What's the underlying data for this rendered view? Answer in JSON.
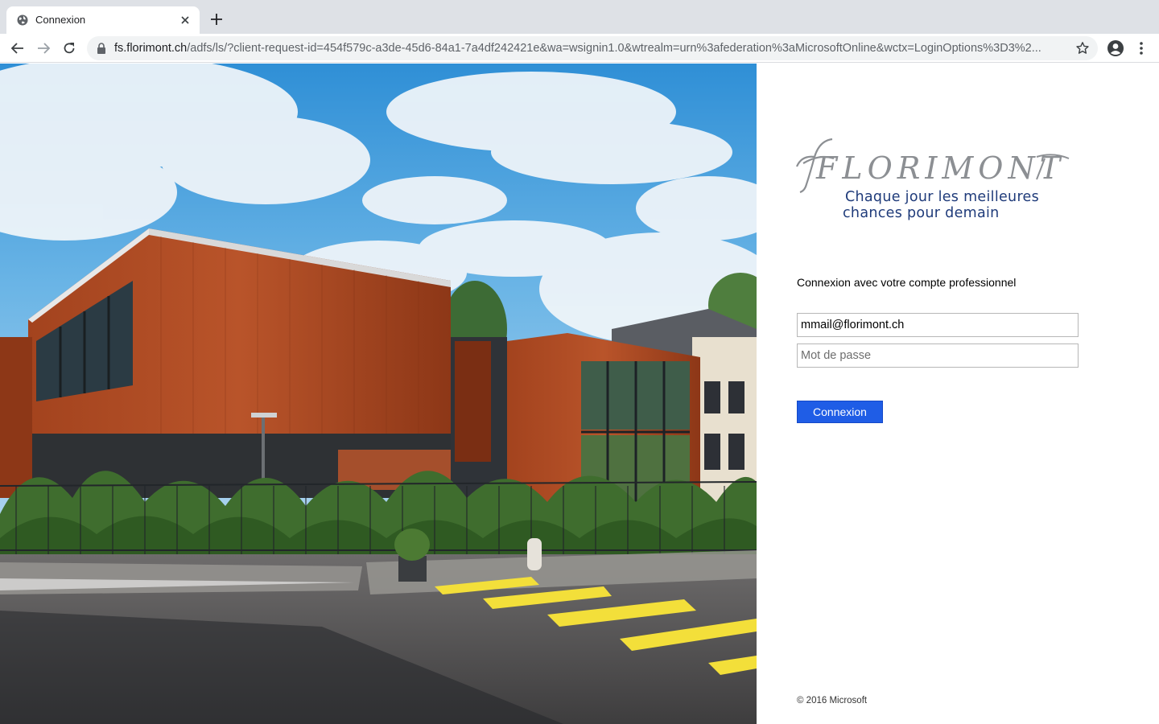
{
  "browser": {
    "tab_title": "Connexion",
    "url_host": "fs.florimont.ch",
    "url_path": "/adfs/ls/?client-request-id=454f579c-a3de-45d6-84a1-7a4df242421e&wa=wsignin1.0&wtrealm=urn%3afederation%3aMicrosoftOnline&wctx=LoginOptions%3D3%2..."
  },
  "logo": {
    "wordmark": "FLORIMONT",
    "tagline_line1": "Chaque jour les meilleures",
    "tagline_line2": "chances pour demain"
  },
  "login": {
    "heading": "Connexion avec votre compte professionnel",
    "username_value": "mmail@florimont.ch",
    "password_placeholder": "Mot de passe",
    "submit_label": "Connexion"
  },
  "footer": {
    "copyright": "© 2016 Microsoft"
  },
  "colors": {
    "accent": "#1f5de6",
    "tagline": "#1f3b7a",
    "wordmark": "#8c8f93"
  }
}
